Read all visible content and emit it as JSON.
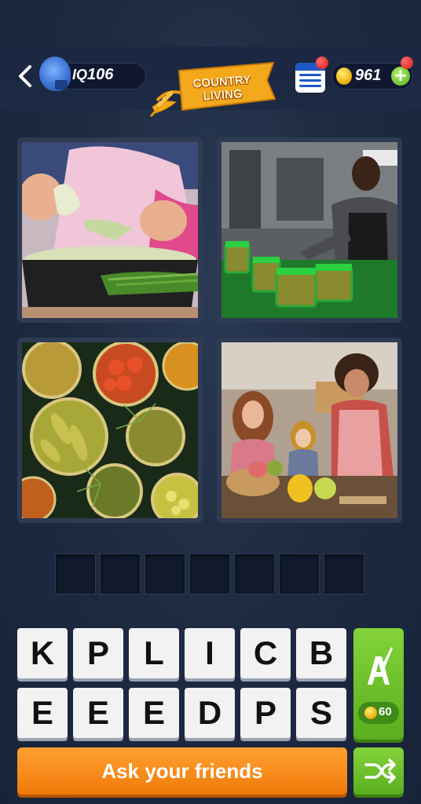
{
  "header": {
    "back_icon": "chevron-left-icon",
    "iq_label": "IQ 106",
    "category": "COUNTRY LIVING",
    "coins": "961",
    "plus_label": "+"
  },
  "photos": [
    {
      "subject": "hands peeling cabbage leaves over a bowl of green beans"
    },
    {
      "subject": "man in apron filling jars with green lids"
    },
    {
      "subject": "open jars of pickles, tomatoes and olives from above"
    },
    {
      "subject": "family cooking together in a kitchen"
    }
  ],
  "answer": {
    "slot_count": 7
  },
  "keyboard": {
    "row1": [
      "K",
      "P",
      "L",
      "I",
      "C",
      "B"
    ],
    "row2": [
      "E",
      "E",
      "E",
      "D",
      "P",
      "S"
    ]
  },
  "hint": {
    "cost": "60",
    "icon": "letter-a-brush-icon"
  },
  "actions": {
    "ask_label": "Ask your friends",
    "shuffle_icon": "shuffle-icon"
  },
  "colors": {
    "background": "#1e2a3d",
    "accent_green": "#6cc22a",
    "accent_orange": "#f58a14",
    "banner_orange": "#f4a81c"
  }
}
